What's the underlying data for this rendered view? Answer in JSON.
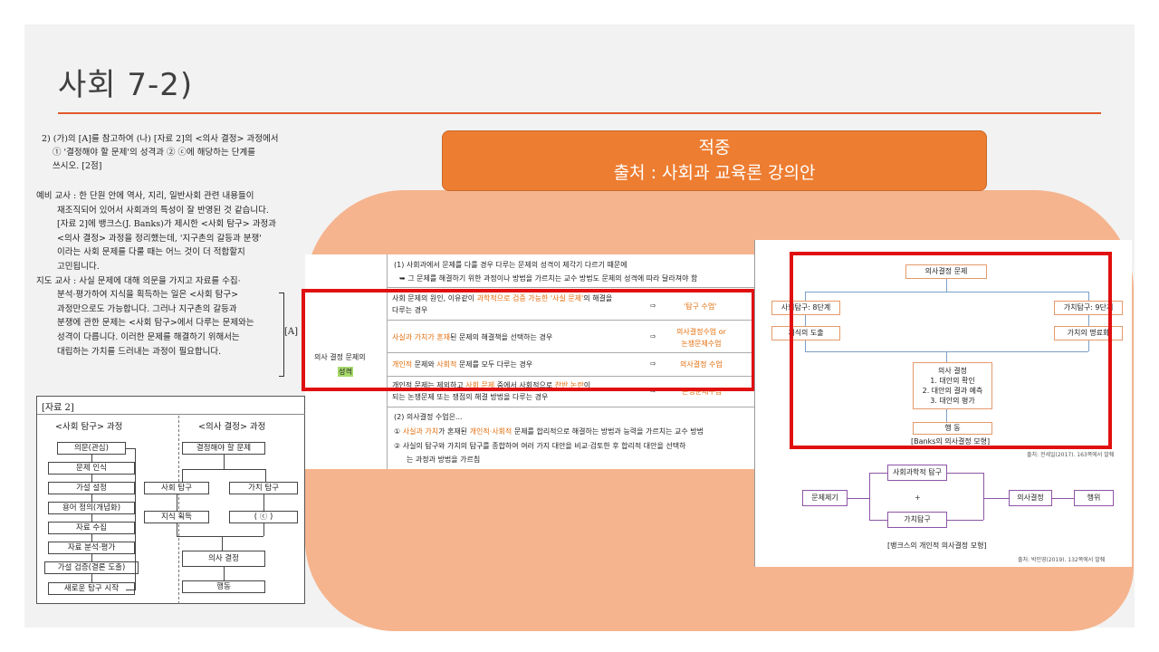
{
  "slide": {
    "title": "사회 7-2)"
  },
  "banner": {
    "line1": "적중",
    "line2": "출처 : 사회과 교육론 강의안"
  },
  "question": {
    "lines": [
      "2) (가)의 [A]를 참고하여 (나) [자료 2]의 <의사 결정> 과정에서",
      "① '결정해야 할 문제'의 성격과 ② ⓒ에 해당하는 단계를",
      "쓰시오. [2점]"
    ]
  },
  "dialog": {
    "lines": [
      "예비 교사 : 한 단원 안에 역사, 지리, 일반사회 관련 내용들이",
      "재조직되어 있어서 사회과의 특성이 잘 반영된 것 같습니다.",
      "[자료 2]에 뱅크스(J. Banks)가 제시한 <사회 탐구> 과정과",
      "<의사 결정> 과정을 정리했는데, '지구촌의 갈등과 분쟁'",
      "이라는 사회 문제를 다룰 때는 어느 것이 더 적합할지",
      "고민됩니다.",
      "지도 교사 : 사실 문제에 대해 의문을 가지고 자료를 수집·",
      "분석·평가하여 지식을 획득하는 일은 <사회 탐구>",
      "과정만으로도 가능합니다. 그러나 지구촌의 갈등과",
      "분쟁에 관한 문제는 <사회 탐구>에서 다루는 문제와는",
      "성격이 다릅니다. 이러한 문제를 해결하기 위해서는",
      "대립하는 가치를 드러내는 과정이 필요합니다."
    ],
    "bracket_label": "[A]"
  },
  "data2": {
    "title": "[자료 2]",
    "left_head": "<사회 탐구> 과정",
    "right_head": "<의사 결정> 과정",
    "left_steps": [
      "의문(관심)",
      "문제 인식",
      "가설 설정",
      "용어 정의(개념화)",
      "자료 수집",
      "자료 분석·평가",
      "가설 검증(결론 도출)",
      "새로운 탐구 시작"
    ],
    "right_top": "결정해야 할 문제",
    "right_a": "사회 탐구",
    "right_b": "가치 탐구",
    "right_c": "지식 획득",
    "right_d": "(          ⓒ          )",
    "right_e": "의사 결정",
    "right_f": "행동"
  },
  "table": {
    "top1": "(1) 사회과에서 문제를 다룰 경우 다루는 문제의 성격이 제각기 다르기 때문에",
    "top2": "➥ 그 문제를 해결하기 위한 과정이나 방법을 가르치는 교수 방법도 문제의 성격에 따라 달라져야 함",
    "row_label_a": "의사 결정 문제의",
    "row_label_b": "성격",
    "r1a": "사회 문제의 원인, 이유같이 ",
    "r1b": "과학적으로 검증 가능한 '사실 문제'",
    "r1c": "의 해결을",
    "r1d": "다루는 경우",
    "r1_result": "'탐구 수업'",
    "r2a": "사실과 가치가 혼재",
    "r2b": "된 문제의 해결책을 선택하는 경우",
    "r2_result_a": "의사결정수업 or",
    "r2_result_b": "논쟁문제수업",
    "r3a": "개인적",
    "r3b": " 문제와 ",
    "r3c": "사회적",
    "r3d": " 문제를 모두 다루는 경우",
    "r3_result": "의사결정 수업",
    "r4a": "개인적 문제는 제외하고 ",
    "r4b": "사회 문제",
    "r4c": " 중에서 사회적으로 ",
    "r4d": "찬반 논란",
    "r4e": "이",
    "r4f": "되는 논쟁문제 또는 쟁점의 해결 방법을 다루는 경우",
    "r4_result": "논쟁문제수업",
    "arrow": "⇨",
    "bot0": "(2) 의사결정 수업은...",
    "bot1a": "① ",
    "bot1b": "사실과 가치",
    "bot1c": "가 혼재된 ",
    "bot1d": "개인적·사회적",
    "bot1e": " 문제를 합리적으로 해결하는 방법과 능력을 가르치는 교수 방법",
    "bot2": "② 사실의 탐구와 가치의 탐구를 종합하여 여러 가지 대안을 비교·검토한 후 합리적 대안을 선택하",
    "bot3": "는 과정과 방법을 가르침"
  },
  "flow": {
    "top": "의사결정 문제",
    "left": "사회탐구: 8단계",
    "right": "가치탐구: 9단계",
    "left2": "지식의 도출",
    "right2": "가치의 명료화",
    "decide_title": "의사 결정",
    "decide_1": "1. 대안의 확인",
    "decide_2": "2. 대안의 결과 예측",
    "decide_3": "3. 대안의 평가",
    "action": "행 동",
    "caption": "[Banks의 의사결정 모형]",
    "src1": "출처: 전세일(2017). 163쪽에서 발췌",
    "m_problem": "문제제기",
    "m_science": "사회과학적 탐구",
    "m_plus": "+",
    "m_value": "가치탐구",
    "m_decide": "의사결정",
    "m_act": "행위",
    "caption2": "[뱅크스의 개인적 의사결정 모형]",
    "src2": "출처: 박인영(2019). 132쪽에서 발췌"
  }
}
